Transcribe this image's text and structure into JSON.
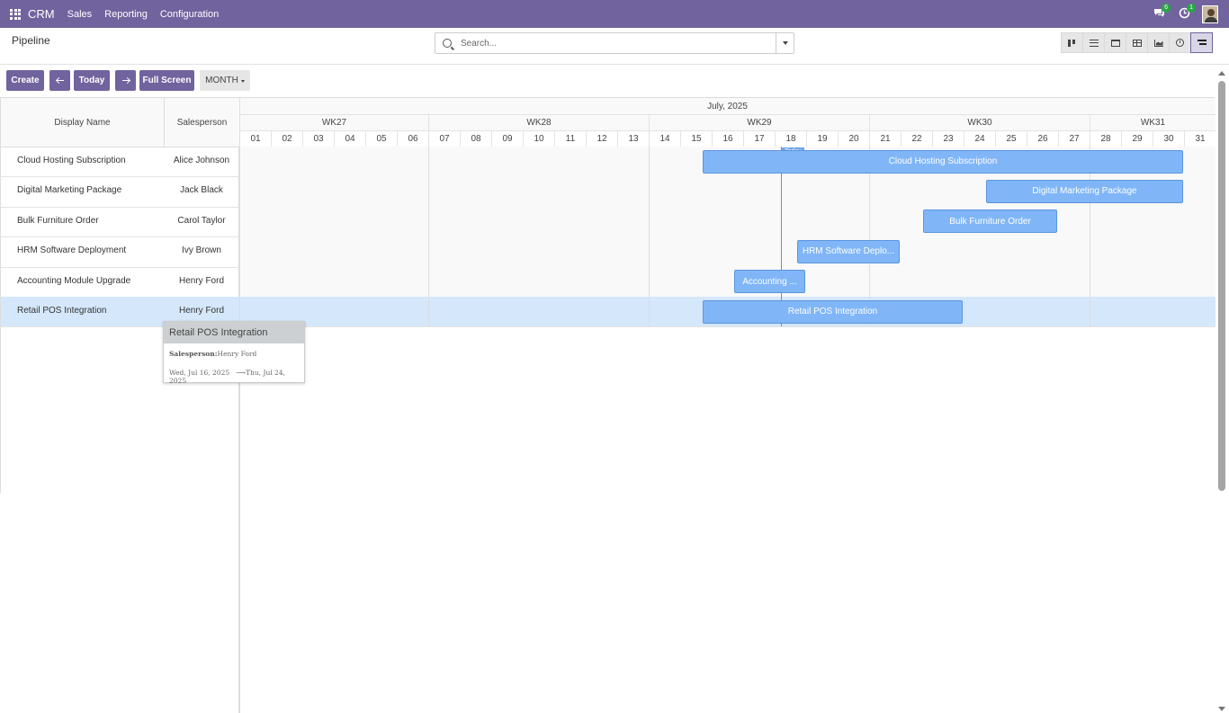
{
  "nav": {
    "brand": "CRM",
    "menu": [
      "Sales",
      "Reporting",
      "Configuration"
    ],
    "messages_badge": "6",
    "activities_badge": "1"
  },
  "control": {
    "breadcrumb": "Pipeline",
    "search_placeholder": "Search...",
    "views": [
      "kanban",
      "list",
      "calendar",
      "pivot",
      "graph",
      "activity",
      "gantt"
    ],
    "active_view": "gantt"
  },
  "toolbar": {
    "create": "Create",
    "today": "Today",
    "full_screen": "Full Screen",
    "scale": "MONTH"
  },
  "gantt": {
    "header_left": "Display Name",
    "header_salesperson": "Salesperson",
    "month_title": "July, 2025",
    "weeks": [
      {
        "label": "WK27",
        "first_day": 1,
        "last_day": 6
      },
      {
        "label": "WK28",
        "first_day": 7,
        "last_day": 13
      },
      {
        "label": "WK29",
        "first_day": 14,
        "last_day": 20
      },
      {
        "label": "WK30",
        "first_day": 21,
        "last_day": 27
      },
      {
        "label": "WK31",
        "first_day": 28,
        "last_day": 31
      }
    ],
    "days": [
      "01",
      "02",
      "03",
      "04",
      "05",
      "06",
      "07",
      "08",
      "09",
      "10",
      "11",
      "12",
      "13",
      "14",
      "15",
      "16",
      "17",
      "18",
      "19",
      "20",
      "21",
      "22",
      "23",
      "24",
      "25",
      "26",
      "27",
      "28",
      "29",
      "30",
      "31"
    ],
    "today_label": "Today",
    "today_day": 18,
    "rows": [
      {
        "name": "Cloud Hosting Subscription",
        "salesperson": "Alice Johnson",
        "pill": "Cloud Hosting Subscription",
        "start": 16,
        "end": 31
      },
      {
        "name": "Digital Marketing Package",
        "salesperson": "Jack Black",
        "pill": "Digital Marketing Package",
        "start": 25,
        "end": 31
      },
      {
        "name": "Bulk Furniture Order",
        "salesperson": "Carol Taylor",
        "pill": "Bulk Furniture Order",
        "start": 23,
        "end": 27
      },
      {
        "name": "HRM Software Deployment",
        "salesperson": "Ivy Brown",
        "pill": "HRM Software Deplo...",
        "start": 19,
        "end": 22
      },
      {
        "name": "Accounting Module Upgrade",
        "salesperson": "Henry Ford",
        "pill": "Accounting ...",
        "start": 17,
        "end": 19
      },
      {
        "name": "Retail POS Integration",
        "salesperson": "Henry Ford",
        "pill": "Retail POS Integration",
        "start": 16,
        "end": 24
      }
    ],
    "highlight_row": 5
  },
  "popover": {
    "title": "Retail POS Integration",
    "salesperson_label": "Salesperson:",
    "salesperson_value": "Henry Ford",
    "date_start": "Wed, Jul 16, 2025",
    "date_arrow": "⟶",
    "date_end": "Thu, Jul 24, 2025"
  },
  "colors": {
    "brand": "#71639e",
    "pill": "#80b6f7",
    "highlight_row": "#d5e7fb"
  }
}
